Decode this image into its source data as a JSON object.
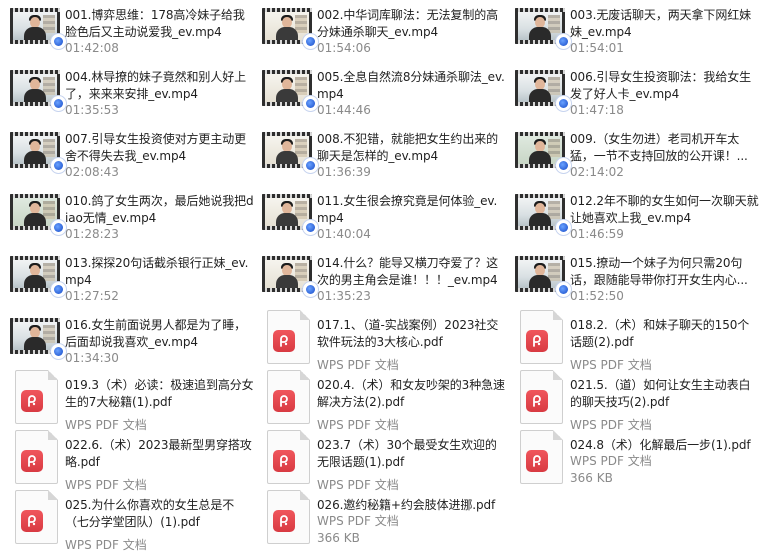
{
  "files": [
    {
      "title": "001.博弈思维：178高冷妹子给我脸色后又主动说爱我_ev.mp4",
      "type": "video",
      "duration": "01:42:08"
    },
    {
      "title": "002.中华词库聊法：无法复制的高分妹通杀聊天_ev.mp4",
      "type": "video",
      "duration": "01:54:06"
    },
    {
      "title": "003.无废话聊天，两天拿下网红妹妹_ev.mp4",
      "type": "video",
      "duration": "01:54:01"
    },
    {
      "title": "004.林导撩的妹子竟然和别人好上了，来来来安排_ev.mp4",
      "type": "video",
      "duration": "01:35:53"
    },
    {
      "title": "005.全息自然流8分妹通杀聊法_ev.mp4",
      "type": "video",
      "duration": "01:44:46"
    },
    {
      "title": "006.引导女生投资聊法：我给女生发了好人卡_ev.mp4",
      "type": "video",
      "duration": "01:47:18"
    },
    {
      "title": "007.引导女生投资使对方更主动更舍不得失去我_ev.mp4",
      "type": "video",
      "duration": "02:08:43"
    },
    {
      "title": "008.不犯错，就能把女生约出来的聊天是怎样的_ev.mp4",
      "type": "video",
      "duration": "01:36:39"
    },
    {
      "title": "009.（女生勿进）老司机开车太猛，一节不支持回放的公开课！...",
      "type": "video",
      "duration": "02:14:02"
    },
    {
      "title": "010.鸽了女生两次，最后她说我把diao无情_ev.mp4",
      "type": "video",
      "duration": "01:28:23"
    },
    {
      "title": "011.女生很会撩究竟是何体验_ev.mp4",
      "type": "video",
      "duration": "01:40:04"
    },
    {
      "title": "012.2年不聊的女生如何一次聊天就让她喜欢上我_ev.mp4",
      "type": "video",
      "duration": "01:46:59"
    },
    {
      "title": "013.探探20句话截杀银行正妹_ev.mp4",
      "type": "video",
      "duration": "01:27:52"
    },
    {
      "title": "014.什么？能导又横刀夺爱了？这次的男主角会是谁！！！_ev.mp4",
      "type": "video",
      "duration": "01:35:23"
    },
    {
      "title": "015.撩动一个妹子为何只需20句话，跟随能导带你打开女生内心...",
      "type": "video",
      "duration": "01:52:50"
    },
    {
      "title": "016.女生前面说男人都是为了睡，后面却说我喜欢_ev.mp4",
      "type": "video",
      "duration": "01:34:30"
    },
    {
      "title": "017.1、（道-实战案例）2023社交软件玩法的3大核心.pdf",
      "type": "pdf",
      "meta": "WPS PDF 文档"
    },
    {
      "title": "018.2.（术）和妹子聊天的150个话题(2).pdf",
      "type": "pdf",
      "meta": "WPS PDF 文档"
    },
    {
      "title": "019.3（术）必读：极速追到高分女生的7大秘籍(1).pdf",
      "type": "pdf",
      "meta": "WPS PDF 文档"
    },
    {
      "title": "020.4.（术）和女友吵架的3种急速解决方法(2).pdf",
      "type": "pdf",
      "meta": "WPS PDF 文档"
    },
    {
      "title": "021.5.（道）如何让女生主动表白的聊天技巧(2).pdf",
      "type": "pdf",
      "meta": "WPS PDF 文档"
    },
    {
      "title": "022.6.（术）2023最新型男穿搭攻略.pdf",
      "type": "pdf",
      "meta": "WPS PDF 文档"
    },
    {
      "title": "023.7（术）30个最受女生欢迎的无限话题(1).pdf",
      "type": "pdf",
      "meta": "WPS PDF 文档"
    },
    {
      "title": "024.8（术）化解最后一步(1).pdf",
      "type": "pdf",
      "meta": "WPS PDF 文档",
      "size": "366 KB"
    },
    {
      "title": "025.为什么你喜欢的女生总是不（七分学堂团队）(1).pdf",
      "type": "pdf",
      "meta": "WPS PDF 文档"
    },
    {
      "title": "026.邀约秘籍+约会肢体进挪.pdf",
      "type": "pdf",
      "meta": "WPS PDF 文档",
      "size": "366 KB"
    }
  ]
}
